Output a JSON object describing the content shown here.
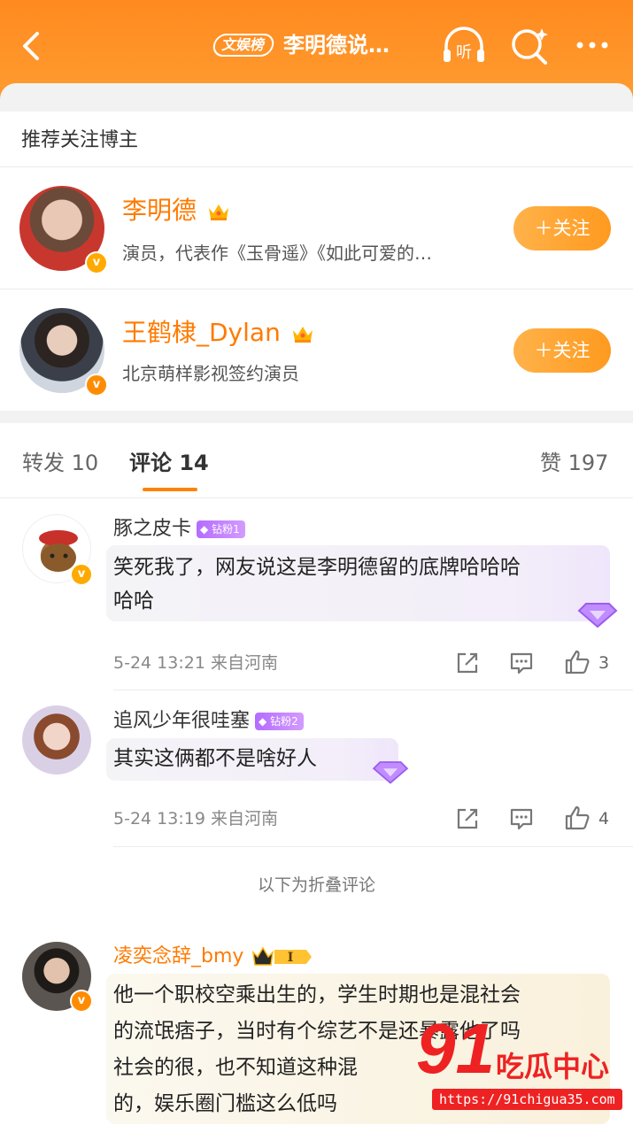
{
  "header": {
    "badge": "文娱榜",
    "title": "李明德说…",
    "listen_label": "听"
  },
  "recommend": {
    "title": "推荐关注博主",
    "users": [
      {
        "name": "李明德",
        "desc": "演员，代表作《玉骨遥》《如此可爱的…",
        "follow": "＋关注",
        "verified": "v"
      },
      {
        "name": "王鹤棣_Dylan",
        "desc": "北京萌样影视签约演员",
        "follow": "＋关注",
        "verified": "v"
      }
    ]
  },
  "tabs": {
    "repost": "转发 10",
    "comment": "评论 14",
    "likes": "赞 197"
  },
  "comments": [
    {
      "name": "豚之皮卡",
      "badge": "钻粉1",
      "text_line1": "笑死我了，网友说这是李明德留的底牌哈哈哈",
      "text_line2": "哈哈",
      "meta": "5-24 13:21 来自河南",
      "likes": "3"
    },
    {
      "name": "追风少年很哇塞",
      "badge": "钻粉2",
      "text_line1": "其实这俩都不是啥好人",
      "meta": "5-24 13:19 来自河南",
      "likes": "4"
    }
  ],
  "fold_notice": "以下为折叠评论",
  "folded_comment": {
    "name": "凌奕念辞_bmy",
    "level_badge": "I",
    "text_lines": [
      "他一个职校空乘出生的，学生时期也是混社会",
      "的流氓痞子，当时有个综艺不是还暴露他了吗",
      "社会的很，也不知道这种混",
      "的，娱乐圈门槛这么低吗"
    ]
  },
  "watermark": {
    "number": "91",
    "text": "吃瓜中心",
    "url": "https://91chigua35.com"
  },
  "colors": {
    "brand": "#ff8a1f",
    "name_orange": "#ff7a00",
    "fan_purple": "#b46cff"
  }
}
